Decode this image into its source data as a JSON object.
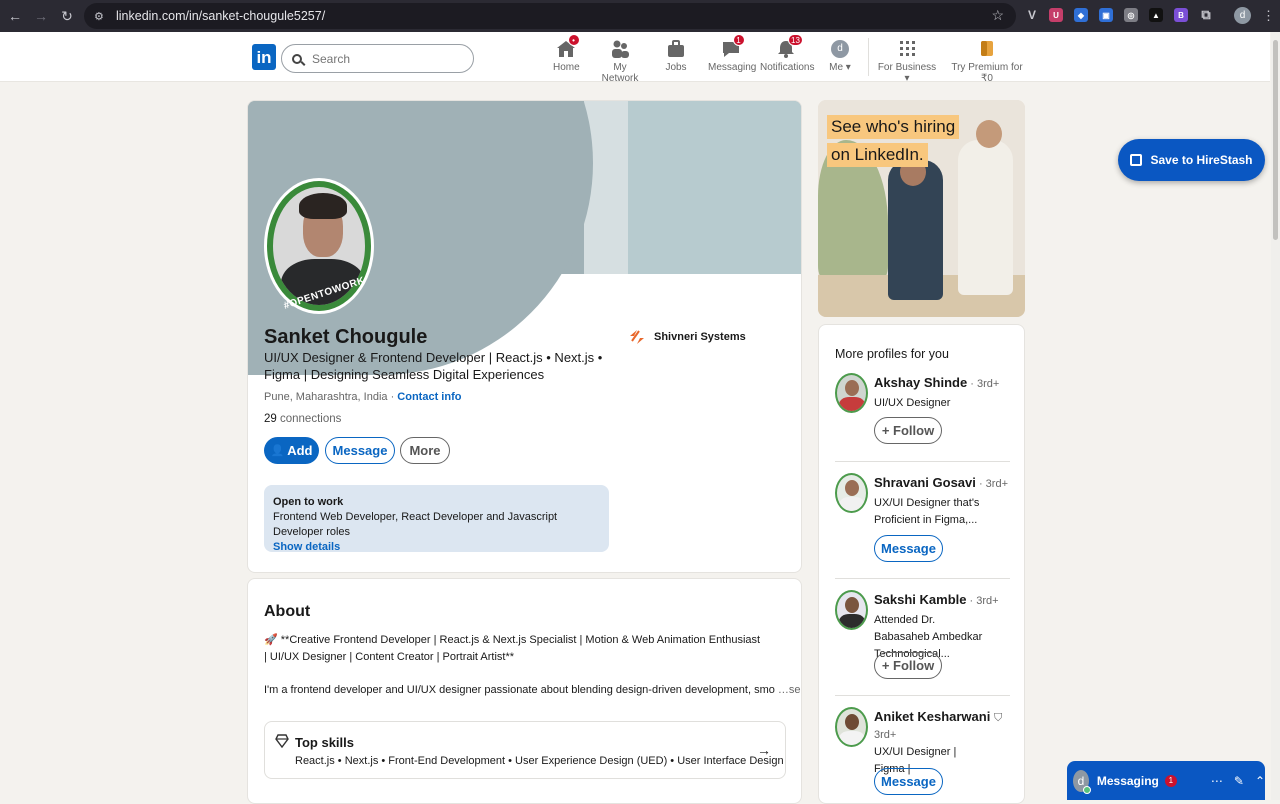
{
  "browser": {
    "url": "linkedin.com/in/sanket-chougule5257/",
    "profile_initial": "d"
  },
  "nav": {
    "search_placeholder": "Search",
    "items": [
      {
        "label": "Home",
        "badge": "•",
        "icon": "home-icon"
      },
      {
        "label": "My Network",
        "badge": "",
        "icon": "people-icon"
      },
      {
        "label": "Jobs",
        "badge": "",
        "icon": "briefcase-icon"
      },
      {
        "label": "Messaging",
        "badge": "1",
        "icon": "message-icon"
      },
      {
        "label": "Notifications",
        "badge": "13",
        "icon": "bell-icon"
      },
      {
        "label": "Me ▾",
        "badge": "",
        "icon": "avatar"
      }
    ],
    "for_business": "For Business ▾",
    "premium": "Try Premium for ₹0",
    "me_initial": "d"
  },
  "profile": {
    "open_to_work_frame": "#OPENTOWORK",
    "name": "Sanket Chougule",
    "headline": "UI/UX Designer & Frontend Developer | React.js • Next.js • Figma | Designing Seamless Digital Experiences",
    "location": "Pune, Maharashtra, India · ",
    "contact_info": "Contact info",
    "connections_count": "29",
    "connections_label": " connections",
    "company": "Shivneri Systems",
    "buttons": {
      "add": "Add",
      "message": "Message",
      "more": "More"
    },
    "open_to_work": {
      "title": "Open to work",
      "roles": "Frontend Web Developer, React Developer and Javascript Developer roles",
      "link": "Show details"
    }
  },
  "about": {
    "title": "About",
    "line1": "🚀 **Creative Frontend Developer | React.js & Next.js Specialist | Motion & Web Animation Enthusiast | UI/UX Designer | Content Creator | Portrait Artist**",
    "line2": "I'm a frontend developer and UI/UX designer passionate about blending design-driven development, smo",
    "see_more": " …see more",
    "top_skills_title": "Top skills",
    "top_skills": "React.js • Next.js • Front-End Development • User Experience Design (UED) • User Interface Design"
  },
  "ad": {
    "line1": "See who's hiring",
    "line2": "on LinkedIn."
  },
  "more_profiles": {
    "title": "More profiles for you",
    "people": [
      {
        "name": "Akshay Shinde",
        "degree": " · 3rd+",
        "desc": "UI/UX Designer",
        "action": "+ Follow"
      },
      {
        "name": "Shravani Gosavi",
        "degree": " · 3rd+",
        "desc": "UX/UI Designer that's Proficient in Figma,...",
        "action": "Message"
      },
      {
        "name": "Sakshi Kamble",
        "degree": " · 3rd+",
        "desc": "Attended Dr. Babasaheb Ambedkar Technological...",
        "action": "+ Follow"
      },
      {
        "name": "Aniket Kesharwani",
        "degree": "3rd+",
        "desc": "UX/UI Designer | Figma |",
        "action": "Message"
      }
    ]
  },
  "hirestash": {
    "label": "Save to HireStash"
  },
  "messaging": {
    "label": "Messaging",
    "badge": "1",
    "initial": "d"
  },
  "colors": {
    "brand": "#0a66c2",
    "open_to_work_green": "#3a8a3a",
    "badge_red": "#cb112d"
  }
}
